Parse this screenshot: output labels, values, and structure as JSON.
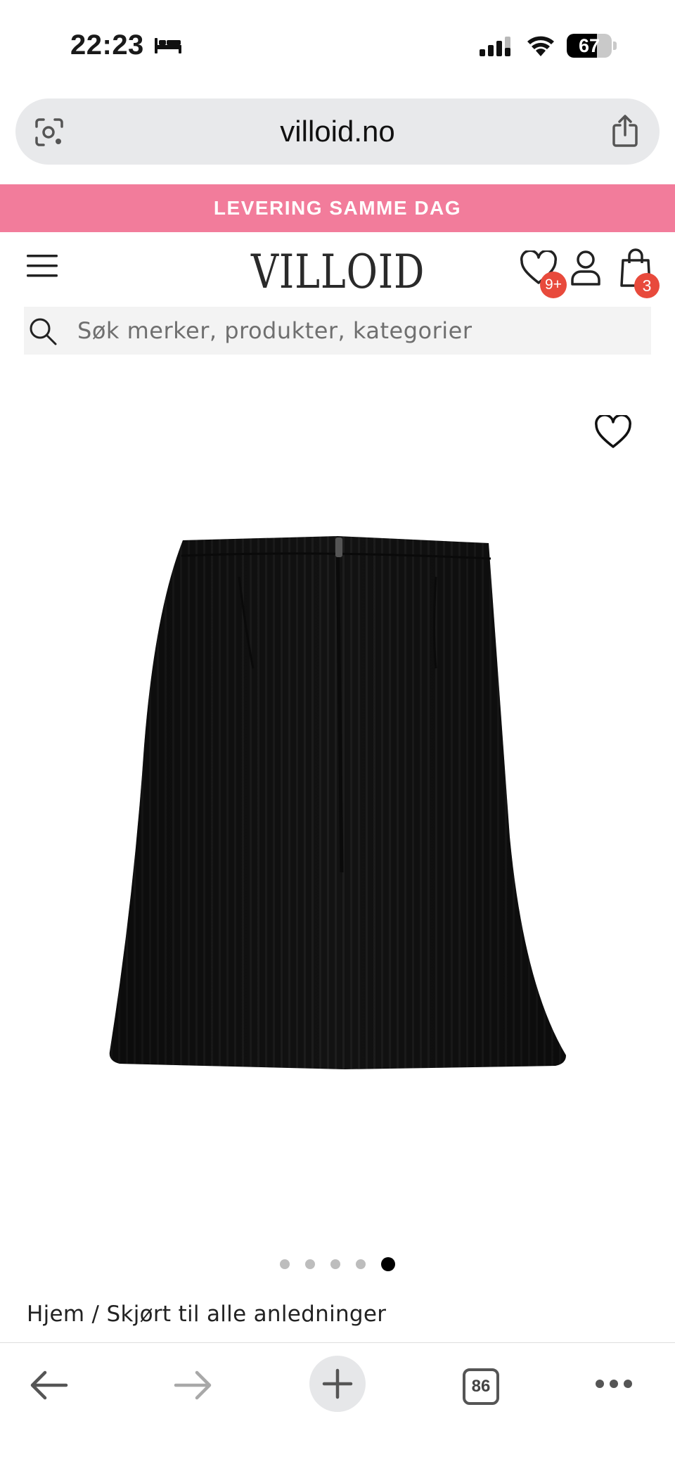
{
  "status_bar": {
    "time": "22:23",
    "battery": "67",
    "battery_level": 0.67
  },
  "browser": {
    "url": "villoid.no",
    "open_tabs": "86"
  },
  "promo": {
    "text": "LEVERING SAMME DAG",
    "color": "#f27c9b"
  },
  "header": {
    "logo": "VILLOID",
    "wishlist_badge": "9+",
    "cart_badge": "3",
    "badge_color": "#e84a3c"
  },
  "search": {
    "placeholder": "Søk merker, produkter, kategorier"
  },
  "gallery": {
    "image_count": 5,
    "active_index": 4
  },
  "breadcrumb": {
    "home": "Hjem",
    "separator": " / ",
    "category": "Skjørt til alle anledninger"
  },
  "icons": [
    "bed-icon",
    "signal-icon",
    "wifi-icon",
    "camera-lens-icon",
    "share-icon",
    "menu-icon",
    "heart-icon",
    "user-icon",
    "shopping-bag-icon",
    "search-icon",
    "back-arrow-icon",
    "forward-arrow-icon",
    "plus-icon",
    "tabs-icon",
    "more-icon"
  ]
}
